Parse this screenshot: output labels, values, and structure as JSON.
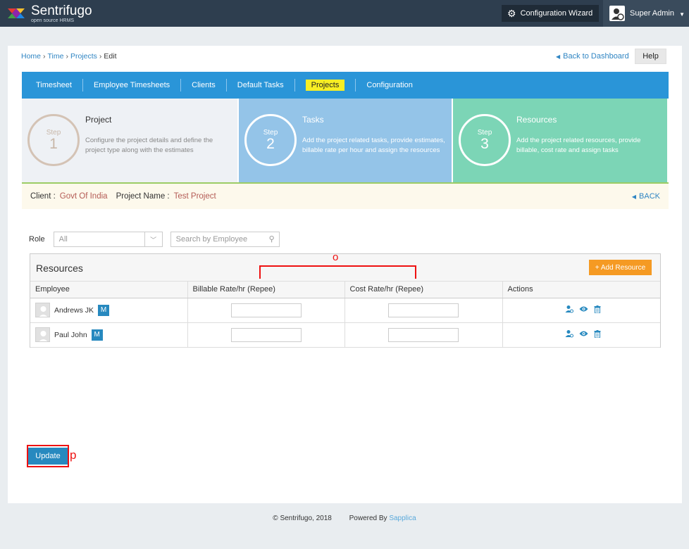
{
  "app": {
    "name": "Sentrifugo",
    "tagline": "open source HRMS",
    "wizard_label": "Configuration Wizard",
    "user_name": "Super Admin"
  },
  "breadcrumb": {
    "home": "Home",
    "time": "Time",
    "projects": "Projects",
    "current": "Edit"
  },
  "header_links": {
    "back_dashboard": "Back to Dashboard",
    "help": "Help"
  },
  "tabs": [
    {
      "label": "Timesheet"
    },
    {
      "label": "Employee Timesheets"
    },
    {
      "label": "Clients"
    },
    {
      "label": "Default Tasks"
    },
    {
      "label": "Projects",
      "active": true
    },
    {
      "label": "Configuration"
    }
  ],
  "steps": [
    {
      "word": "Step",
      "num": "1",
      "title": "Project",
      "desc": "Configure the project details and define the project type along with the estimates"
    },
    {
      "word": "Step",
      "num": "2",
      "title": "Tasks",
      "desc": "Add the project related tasks, provide estimates, billable rate per hour and assign the resources"
    },
    {
      "word": "Step",
      "num": "3",
      "title": "Resources",
      "desc": "Add the project related resources, provide billable, cost rate and assign tasks"
    }
  ],
  "client_bar": {
    "client_label": "Client :",
    "client_value": "Govt Of India",
    "project_label": "Project Name :",
    "project_value": "Test Project",
    "back": "BACK"
  },
  "filters": {
    "role_label": "Role",
    "role_value": "All",
    "search_placeholder": "Search by Employee"
  },
  "resources": {
    "title": "Resources",
    "add_button": "+ Add Resource",
    "columns": [
      "Employee",
      "Billable Rate/hr (Repee)",
      "Cost Rate/hr (Repee)",
      "Actions"
    ],
    "rows": [
      {
        "name": "Andrews JK",
        "badge": "M",
        "billable": "",
        "cost": ""
      },
      {
        "name": "Paul John",
        "badge": "M",
        "billable": "",
        "cost": ""
      }
    ]
  },
  "annotations": {
    "o": "o",
    "p": "p"
  },
  "update_button": "Update",
  "footer": {
    "copyright": "© Sentrifugo, 2018",
    "powered": "Powered By",
    "brand": "Sapplica"
  },
  "colors": {
    "topbar": "#2e3e4f",
    "tabs": "#2a95d8",
    "active_tab": "#f7ee24",
    "accent": "#2789bf",
    "add_button": "#f59a23",
    "annotation": "#ee1111"
  }
}
